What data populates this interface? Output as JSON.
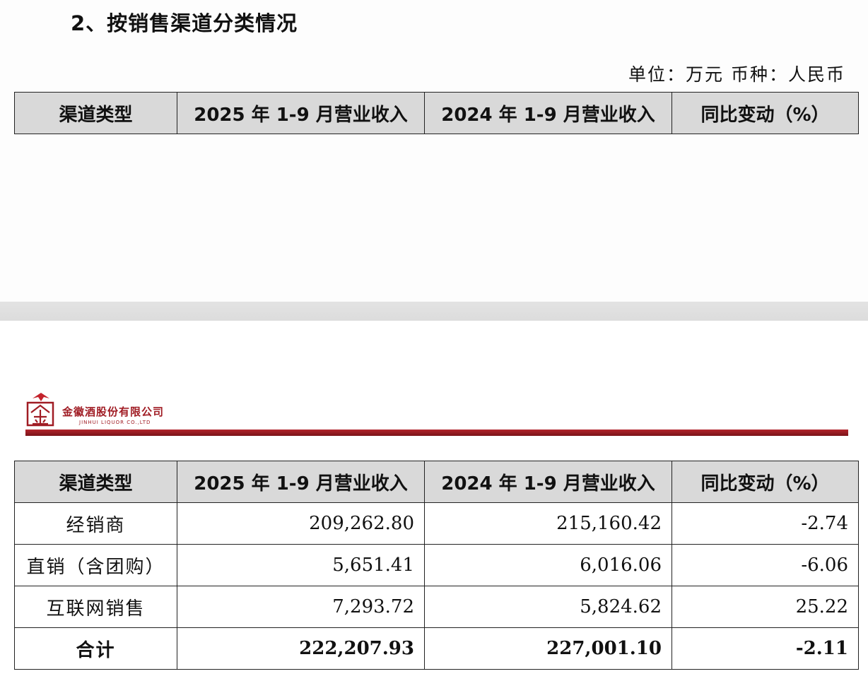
{
  "section_title": "2、按销售渠道分类情况",
  "unit_note": "单位：万元 币种：人民币",
  "logo": {
    "name_cn": "金徽酒股份有限公司",
    "name_en": "JINHUI LIQUOR CO.,LTD"
  },
  "table": {
    "headers": [
      "渠道类型",
      "2025 年 1-9 月营业收入",
      "2024 年 1-9 月营业收入",
      "同比变动（%）"
    ],
    "rows": [
      [
        "经销商",
        "209,262.80",
        "215,160.42",
        "-2.74"
      ],
      [
        "直销（含团购）",
        "5,651.41",
        "6,016.06",
        "-6.06"
      ],
      [
        "互联网销售",
        "7,293.72",
        "5,824.62",
        "25.22"
      ]
    ],
    "total": [
      "合计",
      "222,207.93",
      "227,001.10",
      "-2.11"
    ]
  },
  "colors": {
    "header_fill": "#d9d9d9",
    "brand_red": "#a01c24"
  }
}
